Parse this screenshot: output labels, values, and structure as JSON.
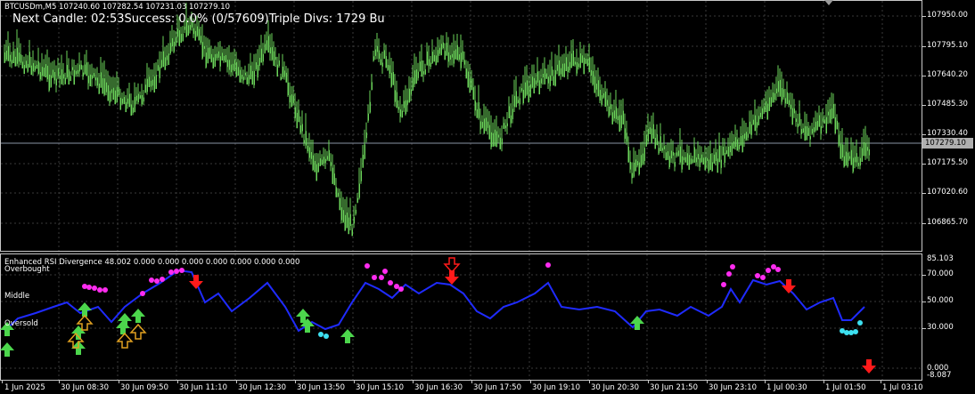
{
  "symbol_line": "BTCUSDm,M5  107240.60 107282.54 107231.03 107279.10",
  "overlay_text": "Next Candle: 02:53Success: 0.0% (0/57609)Triple Divs: 1729 Bu",
  "current_price": "107279.10",
  "price_ticks": [
    "107950.00",
    "107795.10",
    "107640.20",
    "107485.30",
    "107330.40",
    "107175.50",
    "107020.60",
    "106865.70"
  ],
  "indicator": {
    "title": "Enhanced RSI Divergence 48.002 0.000 0.000 0.000 0.000 0.000 0.000 0.000",
    "levels": {
      "overbought": "Overbought",
      "middle": "Middle",
      "oversold": "Oversold"
    },
    "scale_ticks": [
      "85.103",
      "70.000",
      "50.000",
      "30.000",
      "0.000",
      "-8.087"
    ]
  },
  "time_labels": [
    "1 Jun 2025",
    "30 Jun 08:30",
    "30 Jun 09:50",
    "30 Jun 11:10",
    "30 Jun 12:30",
    "30 Jun 13:50",
    "30 Jun 15:10",
    "30 Jun 16:30",
    "30 Jun 17:50",
    "30 Jun 19:10",
    "30 Jun 20:30",
    "30 Jun 21:50",
    "30 Jun 23:10",
    "1 Jul 00:30",
    "1 Jul 01:50",
    "1 Jul 03:10"
  ],
  "colors": {
    "candle": "#6bd45a",
    "rsi_line": "#1f2bff",
    "dots_high": "#ff2cf0",
    "dots_low": "#3de0f0",
    "arrow_up": "#4cd64c",
    "arrow_down": "#ff1a1a",
    "arrow_outline": "#e0a020"
  }
}
